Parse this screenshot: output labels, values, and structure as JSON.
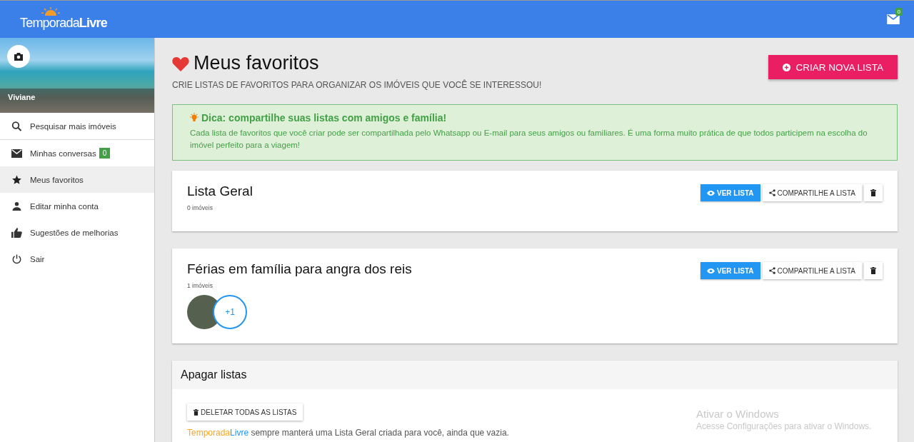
{
  "header": {
    "logo": {
      "part_1": "Temporada",
      "part_2": "Livre"
    },
    "messages_badge": "0"
  },
  "sidebar": {
    "user_name": "Viviane",
    "items": [
      {
        "kind": "search",
        "label": "Pesquisar mais imóveis",
        "selected": false
      },
      {
        "kind": "mail",
        "label": "Minhas conversas",
        "badge": "0",
        "selected": false
      },
      {
        "kind": "star",
        "label": "Meus favoritos",
        "selected": true
      },
      {
        "kind": "person",
        "label": "Editar minha conta",
        "selected": false
      },
      {
        "kind": "thumb",
        "label": "Sugestões de melhorias",
        "selected": false
      },
      {
        "kind": "power",
        "label": "Sair",
        "selected": false
      }
    ]
  },
  "page": {
    "title": "Meus favoritos",
    "subtitle": "CRIE LISTAS DE FAVORITOS PARA ORGANIZAR OS IMÓVEIS QUE VOCÊ SE INTERESSOU!",
    "create_button": "CRIAR NOVA LISTA"
  },
  "tip": {
    "title": "Dica: compartilhe suas listas com amigos e família!",
    "text": "Cada lista de favoritos que você criar pode ser compartilhada pelo Whatsapp ou E-mail para seus amigos ou familiares. É uma forma muito prática de que todos participem na escolha do imóvel perfeito para a viagem!"
  },
  "lists": [
    {
      "name": "Lista Geral",
      "count": "0 imóveis",
      "view_button": "VER LISTA",
      "share_button": "COMPARTILHE A LISTA"
    },
    {
      "name": "Férias em família para angra dos reis",
      "count": "1 imóveis",
      "view_button": "VER LISTA",
      "share_button": "COMPARTILHE A LISTA",
      "more": "+1"
    }
  ],
  "delete_section": {
    "title": "Apagar listas",
    "button": "DELETAR TODAS AS LISTAS",
    "note": [
      {
        "kind": "brand_1",
        "text": "Temporada"
      },
      {
        "kind": "brand_2",
        "text": "Livre"
      },
      {
        "kind": "plain",
        "text": " sempre manterá uma Lista Geral criada para você, ainda que vazia."
      }
    ]
  },
  "os_notice": {
    "title": "Ativar o Windows",
    "text": "Acesse Configurações para ativar o Windows."
  }
}
